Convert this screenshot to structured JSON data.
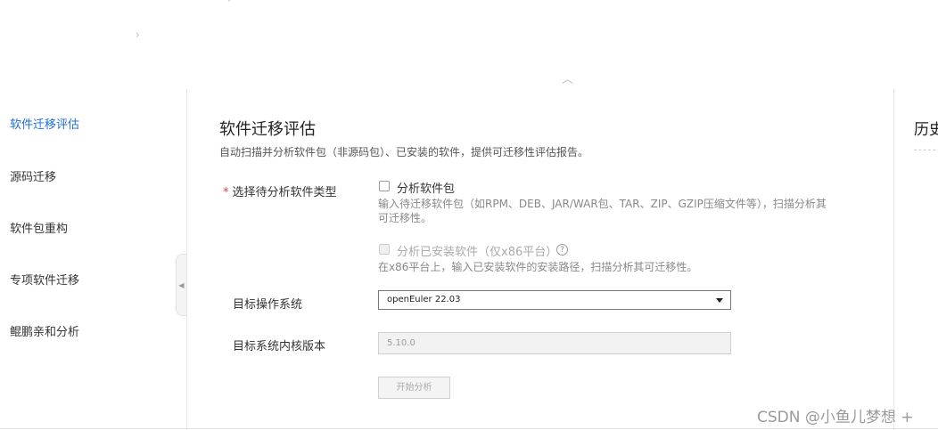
{
  "sidebar": {
    "items": [
      {
        "label": "软件迁移评估",
        "active": true
      },
      {
        "label": "源码迁移",
        "active": false
      },
      {
        "label": "软件包重构",
        "active": false
      },
      {
        "label": "专项软件迁移",
        "active": false
      },
      {
        "label": "鲲鹏亲和分析",
        "active": false
      }
    ]
  },
  "main": {
    "title": "软件迁移评估",
    "description": "自动扫描并分析软件包（非源码包）、已安装的软件，提供可迁移性评估报告。",
    "form": {
      "type_label": "选择待分析软件类型",
      "required_mark": "*",
      "option_package": {
        "label": "分析软件包",
        "hint_line1": "输入待迁移软件包（如RPM、DEB、JAR/WAR包、TAR、ZIP、GZIP压缩文件等），扫描分析其",
        "hint_line2": "可迁移性。",
        "checked": false
      },
      "option_installed": {
        "label": "分析已安装软件（仅x86平台）",
        "hint": "在x86平台上，输入已安装软件的安装路径，扫描分析其可迁移性。",
        "help_icon": "question-circle-icon",
        "help_glyph": "?",
        "disabled": true
      },
      "os_label": "目标操作系统",
      "os_value": "openEuler 22.03",
      "kernel_label": "目标系统内核版本",
      "kernel_value": "5.10.0",
      "start_button": "开始分析"
    }
  },
  "right_panel": {
    "title": "历史"
  },
  "watermark": "CSDN @小鱼儿梦想 +",
  "colors": {
    "accent": "#1d6fd6",
    "required": "#e4393c"
  }
}
